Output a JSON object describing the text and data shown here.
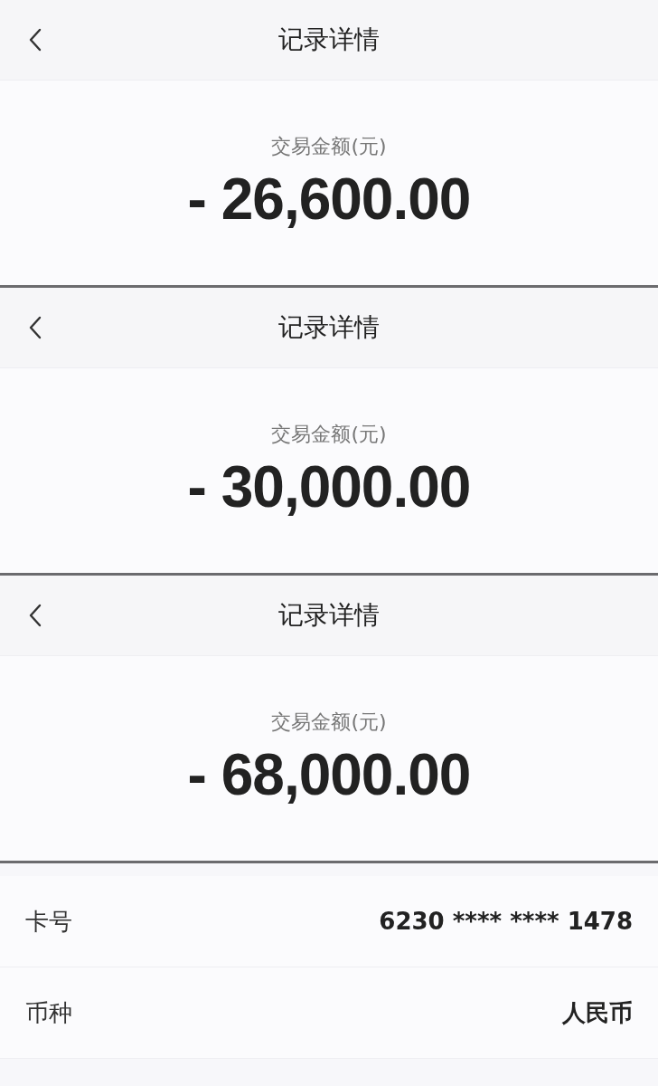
{
  "panels": [
    {
      "title": "记录详情",
      "amount_label": "交易金额(元)",
      "amount": "- 26,600.00"
    },
    {
      "title": "记录详情",
      "amount_label": "交易金额(元)",
      "amount": "- 30,000.00"
    },
    {
      "title": "记录详情",
      "amount_label": "交易金额(元)",
      "amount": "- 68,000.00"
    }
  ],
  "details": [
    {
      "label": "卡号",
      "value": "6230 **** **** 1478"
    },
    {
      "label": "币种",
      "value": "人民币"
    }
  ]
}
